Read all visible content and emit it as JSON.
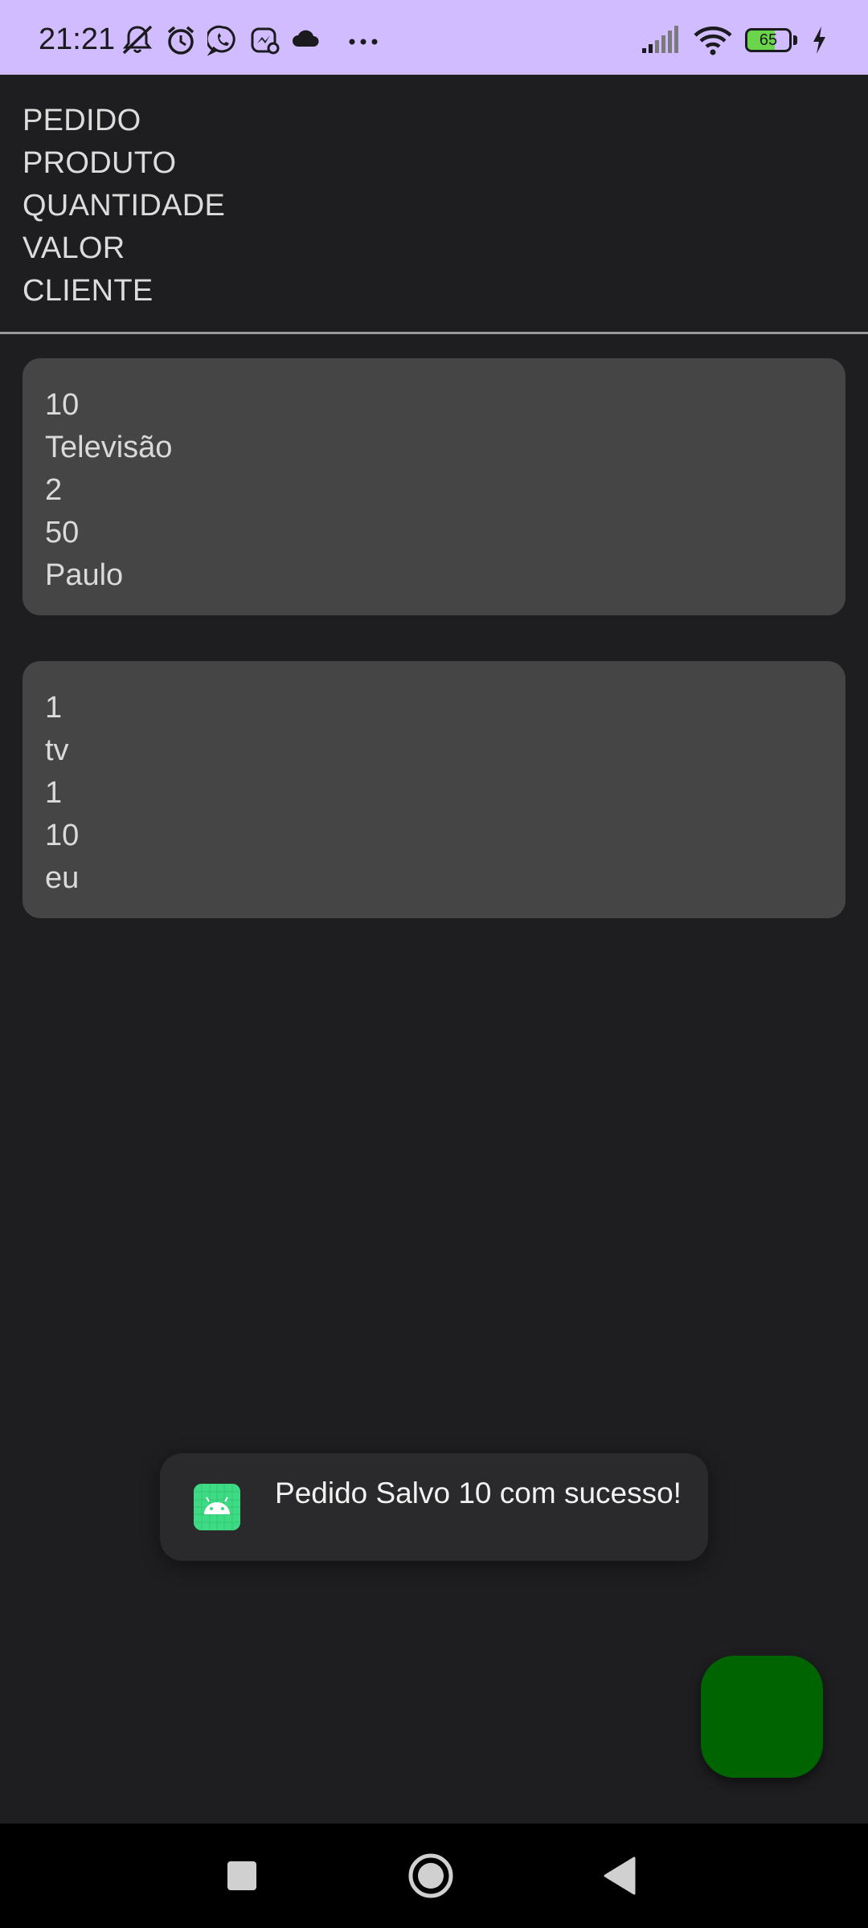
{
  "status_bar": {
    "time": "21:21",
    "battery_level": "65",
    "battery_fraction": 0.65,
    "left_icons": [
      "mute-icon",
      "alarm-icon",
      "whatsapp-icon",
      "messenger-icon",
      "cloud-icon",
      "more-dots-icon"
    ],
    "right_icons": [
      "signal-icon",
      "wifi-icon",
      "battery-icon",
      "charging-icon"
    ],
    "background_color": "#d0bcff"
  },
  "header": {
    "labels": [
      "PEDIDO",
      "PRODUTO",
      "QUANTIDADE",
      "VALOR",
      "CLIENTE"
    ]
  },
  "orders": [
    {
      "pedido": "10",
      "produto": "Televisão",
      "quantidade": "2",
      "valor": "50",
      "cliente": "Paulo"
    },
    {
      "pedido": "1",
      "produto": "tv",
      "quantidade": "1",
      "valor": "10",
      "cliente": "eu"
    }
  ],
  "toast": {
    "icon": "android-app-icon",
    "message": "Pedido Salvo 10 com sucesso!"
  },
  "fab": {
    "color": "#006400"
  },
  "nav_bar": {
    "buttons": [
      "recents-square-icon",
      "home-circle-icon",
      "back-triangle-icon"
    ]
  },
  "colors": {
    "background": "#1e1e21",
    "card": "#454545",
    "text": "#dcdcdc",
    "toast_background": "#2a2a2c"
  }
}
